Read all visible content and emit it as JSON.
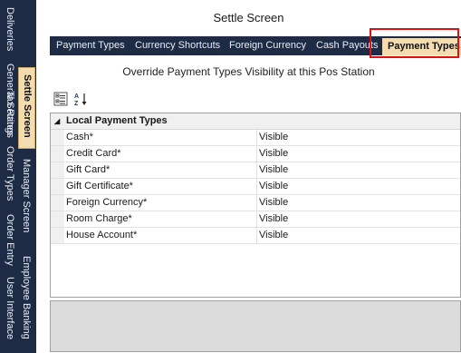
{
  "side_tabs": {
    "column1": [
      "Deliveries",
      "General Settings",
      "Tax Rates",
      "Order Types",
      "Order Entry",
      "User Interface"
    ],
    "column2": [
      "Settle Screen",
      "Manager Screen",
      "Employee Banking"
    ]
  },
  "screen_title": "Settle Screen",
  "top_tabs": [
    "Payment Types",
    "Currency Shortcuts",
    "Foreign Currency",
    "Cash Payouts",
    "Payment Types"
  ],
  "active_top_tab": "Payment Types",
  "subtitle": "Override Payment Types Visibility at this Pos Station",
  "toolbar": {
    "categorized_icon": "categorized-icon",
    "alphabetical_icon": "sort-alphabetical-icon"
  },
  "grid": {
    "category": "Local Payment Types",
    "rows": [
      {
        "name": "Cash*",
        "value": "Visible"
      },
      {
        "name": "Credit Card*",
        "value": "Visible"
      },
      {
        "name": "Gift Card*",
        "value": "Visible"
      },
      {
        "name": "Gift Certificate*",
        "value": "Visible"
      },
      {
        "name": "Foreign Currency*",
        "value": "Visible"
      },
      {
        "name": "Room Charge*",
        "value": "Visible"
      },
      {
        "name": "House Account*",
        "value": "Visible"
      }
    ]
  },
  "colors": {
    "nav_bg": "#1e2b45",
    "active_tab_bg": "#f3ddb0",
    "highlight": "#e01010"
  }
}
